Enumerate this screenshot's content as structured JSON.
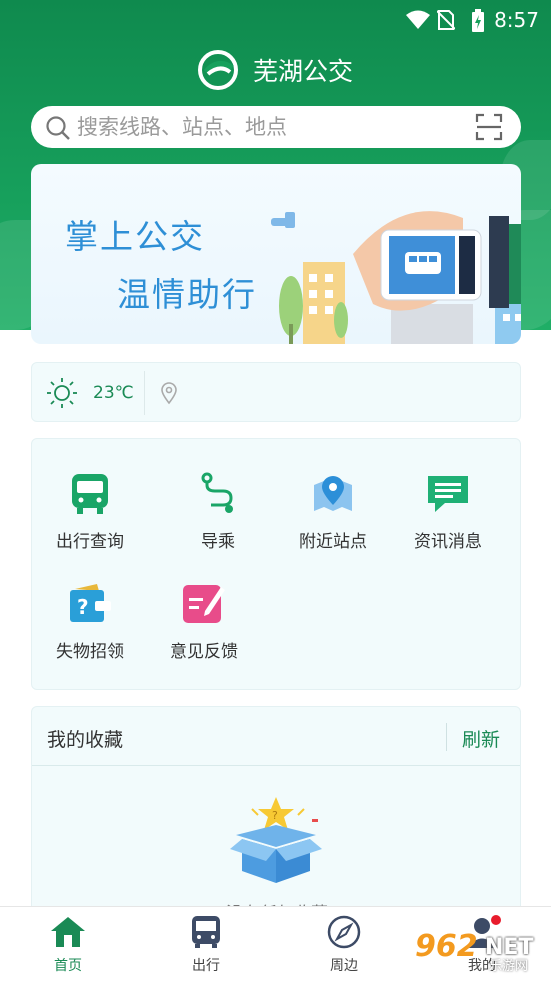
{
  "status_bar": {
    "time": "8:57"
  },
  "app": {
    "title": "芜湖公交"
  },
  "search": {
    "placeholder": "搜索线路、站点、地点"
  },
  "banner": {
    "line1": "掌上公交",
    "line2": "温情助行"
  },
  "weather": {
    "temperature": "23℃"
  },
  "services": [
    {
      "label": "出行查询",
      "icon": "bus-icon",
      "color": "#1aa567"
    },
    {
      "label": "导乘",
      "icon": "route-icon",
      "color": "#1aa567"
    },
    {
      "label": "附近站点",
      "icon": "map-pin-icon",
      "color": "#2c8fd8"
    },
    {
      "label": "资讯消息",
      "icon": "message-icon",
      "color": "#1fb075"
    },
    {
      "label": "失物招领",
      "icon": "lost-found-icon",
      "color": "#2a9fd8"
    },
    {
      "label": "意见反馈",
      "icon": "feedback-icon",
      "color": "#e84c8a"
    }
  ],
  "favorites": {
    "title": "我的收藏",
    "refresh": "刷新",
    "empty_text": "没有任何收藏"
  },
  "tabs": [
    {
      "label": "首页",
      "icon": "home-icon",
      "active": true
    },
    {
      "label": "出行",
      "icon": "bus-icon",
      "active": false
    },
    {
      "label": "周边",
      "icon": "compass-icon",
      "active": false
    },
    {
      "label": "我的",
      "icon": "user-icon",
      "active": false
    }
  ],
  "watermark": {
    "number": "962",
    "net": "NET",
    "sub": "乐游网"
  },
  "colors": {
    "primary": "#1a8a55",
    "header": "#17a05c",
    "accent_blue": "#2e8fd6"
  }
}
